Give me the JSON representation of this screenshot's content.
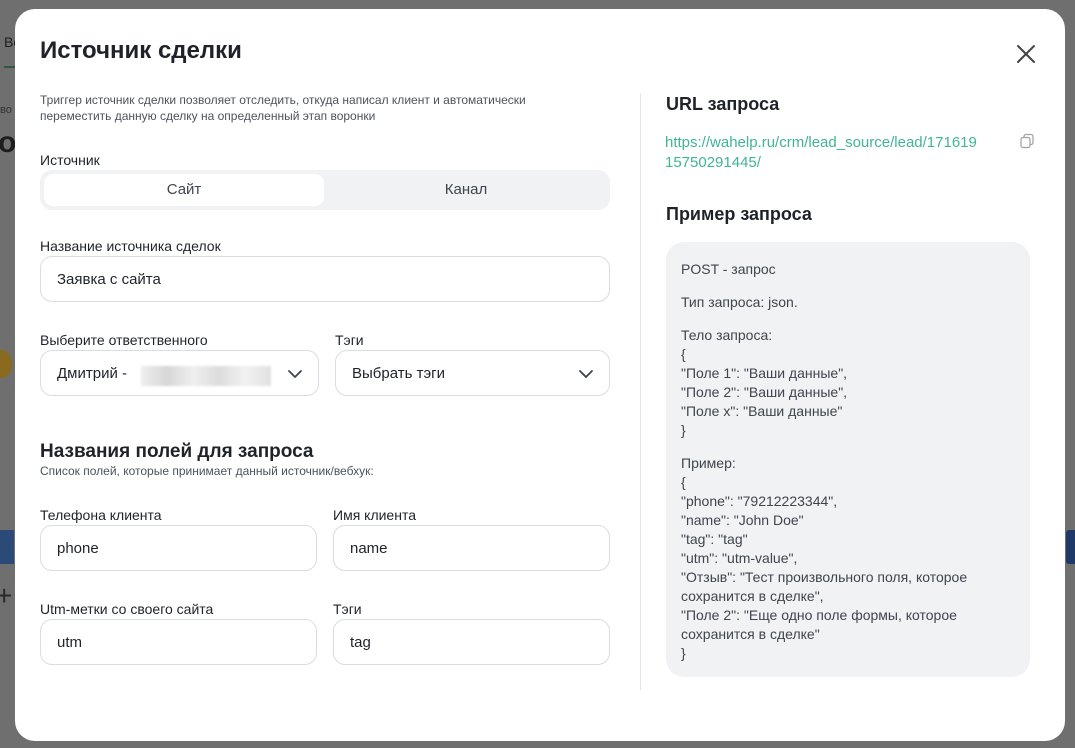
{
  "background": {
    "tab_fragment": "Во",
    "small_fragment": "во",
    "big_fragment": "ор",
    "plus": "+"
  },
  "modal": {
    "title": "Источник сделки",
    "description": "Триггер источник сделки позволяет отследить, откуда написал клиент и автоматически переместить данную сделку на определенный этап воронки",
    "source": {
      "label": "Источник",
      "options": [
        "Сайт",
        "Канал"
      ],
      "selected": "Сайт"
    },
    "deal_source_name": {
      "label": "Название источника сделок",
      "value": "Заявка с сайта"
    },
    "responsible": {
      "label": "Выберите ответственного",
      "value": "Дмитрий -"
    },
    "tags": {
      "label": "Тэги",
      "value": "Выбрать тэги"
    },
    "fields_section": {
      "title": "Названия полей для запроса",
      "subtitle": "Список полей, которые принимает данный источник/вебхук:"
    },
    "fields": [
      {
        "label": "Телефона клиента",
        "value": "phone"
      },
      {
        "label": "Имя клиента",
        "value": "name"
      },
      {
        "label": "Utm-метки со своего сайта",
        "value": "utm"
      },
      {
        "label": "Тэги",
        "value": "tag"
      }
    ],
    "url_section": {
      "title": "URL запроса",
      "url": "https://wahelp.ru/crm/lead_source/lead/17161915750291445/"
    },
    "example_section": {
      "title": "Пример запроса",
      "lines": {
        "method": "POST - запрос",
        "type": "Тип запроса: json.",
        "body_label": "Тело запроса:",
        "body_open": "{",
        "body_1": "\"Поле 1\": \"Ваши данные\",",
        "body_2": "\"Поле 2\": \"Ваши данные\",",
        "body_x": "\"Поле x\": \"Ваши данные\"",
        "body_close": "}",
        "example_label": "Пример:",
        "ex_open": "{",
        "ex_phone": "\"phone\": \"79212223344\",",
        "ex_name": "\"name\": \"John Doe\"",
        "ex_tag": "\"tag\": \"tag\"",
        "ex_utm": "\"utm\": \"utm-value\",",
        "ex_review": "\"Отзыв\": \"Тест произвольного поля, которое сохранится в сделке\",",
        "ex_field2": "\"Поле 2\": \"Еще одно поле формы, которое сохранится в сделке\"",
        "ex_close": "}"
      }
    }
  },
  "colors": {
    "accent_link": "#3fb594",
    "overlay": "#6f6f6f",
    "panel_gray": "#f1f2f4"
  },
  "icons": {
    "close": "close-icon",
    "chevron": "chevron-down-icon",
    "copy": "copy-icon"
  }
}
